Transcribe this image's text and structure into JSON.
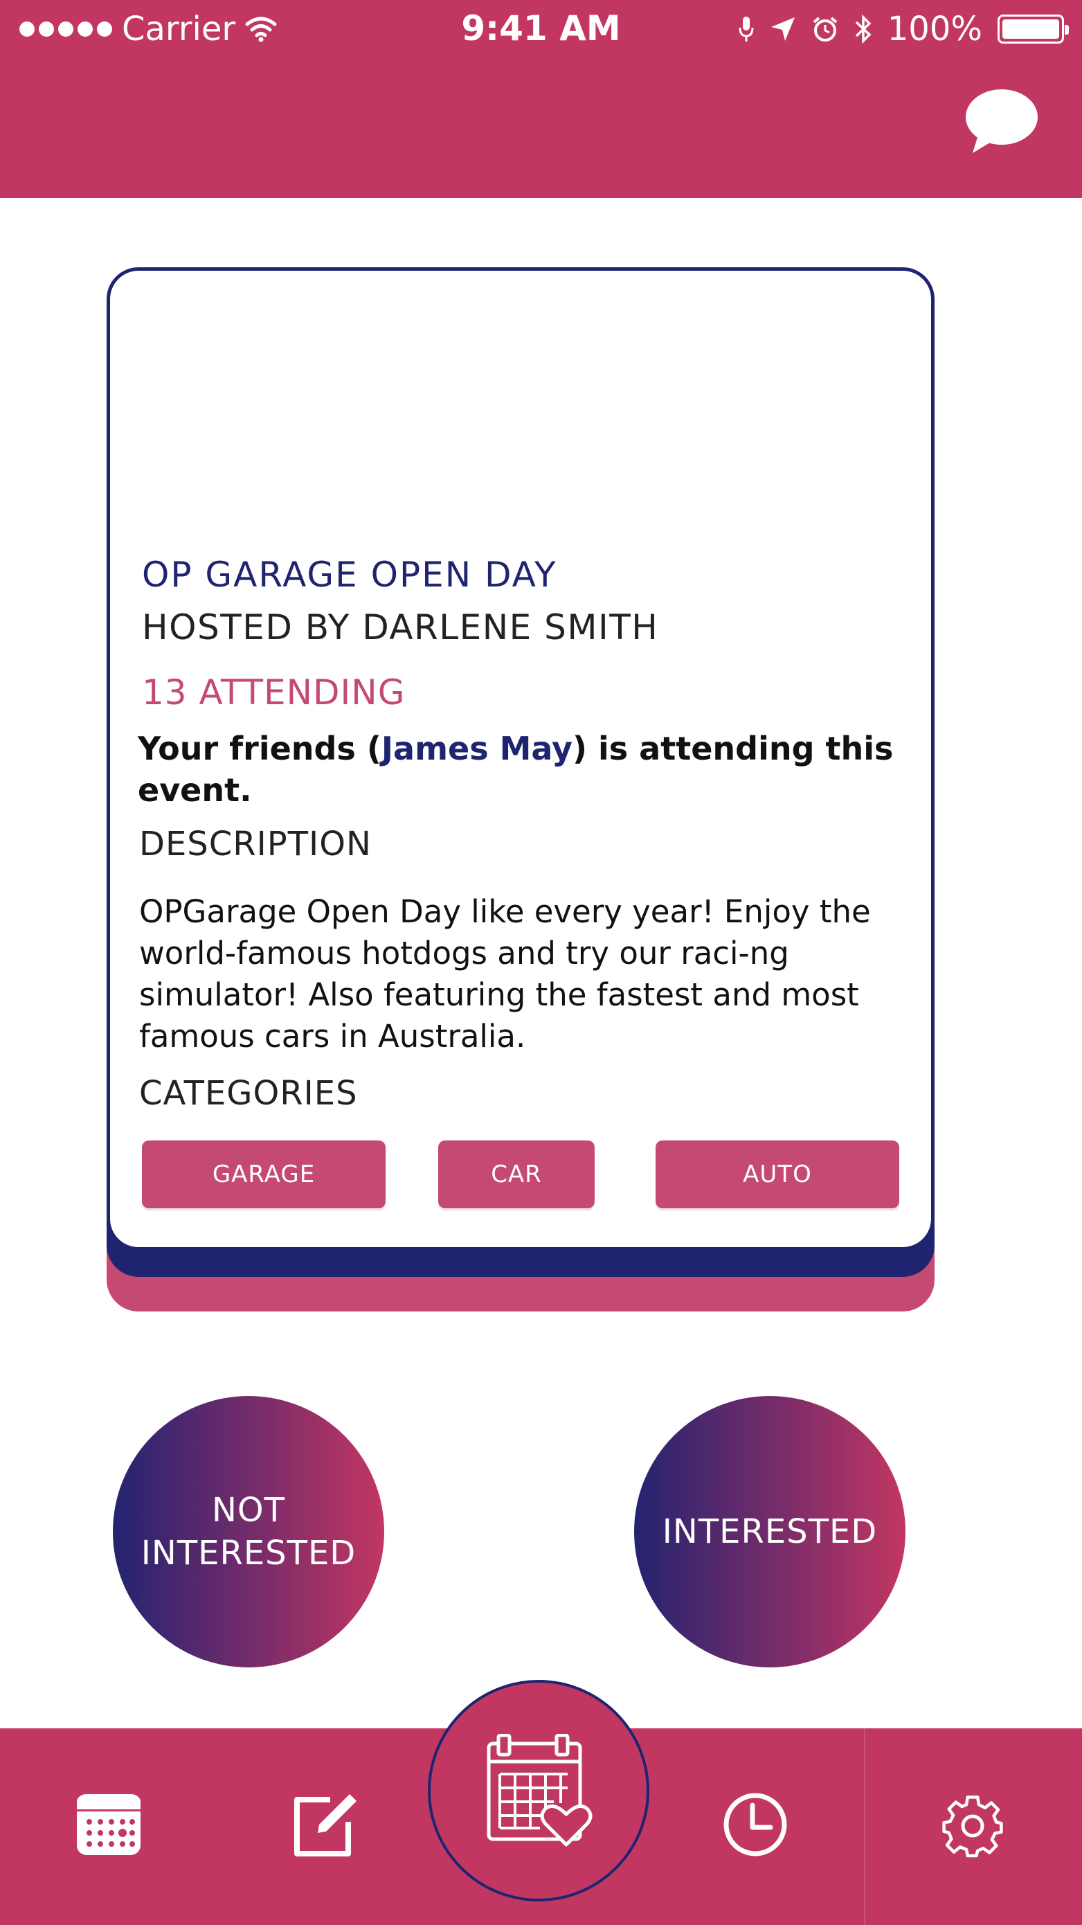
{
  "status_bar": {
    "carrier": "Carrier",
    "time": "9:41 AM",
    "battery": "100%"
  },
  "colors": {
    "brand": "#c23762",
    "navy": "#1f2470",
    "chip": "#c54a71"
  },
  "event": {
    "title": "OP GARAGE OPEN DAY",
    "host": "HOSTED BY DARLENE SMITH",
    "attending": "13 ATTENDING",
    "friends_prefix": "Your friends (",
    "friend_name": "James May",
    "friends_suffix": ") is attending this event.",
    "description_heading": "DESCRIPTION",
    "description": "OPGarage Open Day like every year! Enjoy the world-famous hotdogs and try our raci-ng simulator! Also featuring the fastest and most famous cars in Australia.",
    "categories_heading": "CATEGORIES",
    "categories": [
      "GARAGE",
      "CAR",
      "AUTO"
    ]
  },
  "actions": {
    "not_interested": "NOT INTERESTED",
    "interested": "INTERESTED"
  },
  "tabs": [
    "calendar-icon",
    "edit-icon",
    "calendar-heart-icon",
    "clock-icon",
    "gear-icon"
  ]
}
